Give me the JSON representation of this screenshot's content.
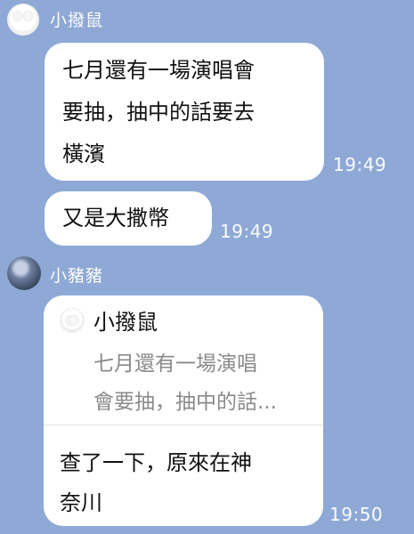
{
  "chat": {
    "sender1": "小撥鼠",
    "sender2": "小豬豬",
    "messages": [
      {
        "lines": [
          "七月還有一場演唱會",
          "要抽，抽中的話要去",
          "橫濱"
        ],
        "time": "19:49"
      },
      {
        "text": "又是大撒幣",
        "time": "19:49"
      }
    ],
    "reply": {
      "quoted_name": "小撥鼠",
      "quoted_lines": [
        "七月還有一場演唱",
        "會要抽，抽中的話..."
      ],
      "message_lines": [
        "查了一下，原來在神",
        "奈川"
      ],
      "time": "19:50"
    }
  }
}
